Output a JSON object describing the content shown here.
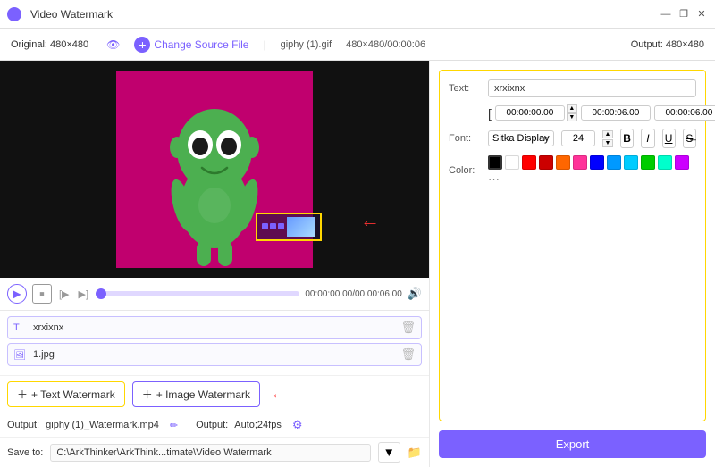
{
  "app": {
    "title": "Video Watermark",
    "logo_color": "#7b61ff"
  },
  "title_bar": {
    "title": "Video Watermark",
    "minimize_label": "—",
    "restore_label": "❐",
    "close_label": "✕"
  },
  "toolbar": {
    "original_label": "Original:",
    "original_dims": "480×480",
    "change_source_label": "Change Source File",
    "filename": "giphy (1).gif",
    "file_dims": "480×480/00:00:06",
    "output_label": "Output:",
    "output_dims": "480×480"
  },
  "playback": {
    "time_current": "00:00:00.00",
    "time_total": "00:00:06.00",
    "time_display": "00:00:00.00/00:00:06.00"
  },
  "watermark_items": [
    {
      "id": "wm-text",
      "icon": "T",
      "label": "xrxixnx"
    },
    {
      "id": "wm-image",
      "icon": "🖼",
      "label": "1.jpg"
    }
  ],
  "add_buttons": {
    "add_text_label": "+ Text Watermark",
    "add_image_label": "+ Image Watermark"
  },
  "output_row": {
    "output_label": "Output:",
    "output_filename": "giphy (1)_Watermark.mp4",
    "output_format_label": "Output:",
    "output_format": "Auto;24fps"
  },
  "save_row": {
    "save_label": "Save to:",
    "save_path": "C:\\ArkThinker\\ArkThink...timate\\Video Watermark"
  },
  "properties_panel": {
    "text_label": "Text:",
    "text_value": "xrxixnx",
    "time_start": "00:00:00.00",
    "time_end": "00:00:06.00",
    "time_end2": "00:00:06.00",
    "font_label": "Font:",
    "font_name": "Sitka Display",
    "font_size": "24",
    "color_label": "Color:",
    "style_bold": "B",
    "style_italic": "I",
    "style_underline": "U",
    "style_strikethrough": "S",
    "export_label": "Export"
  },
  "colors": {
    "swatches": [
      "#000000",
      "#ffffff",
      "#ff0000",
      "#cc0000",
      "#ff6600",
      "#ff3399",
      "#0000ff",
      "#0099ff",
      "#00ccff",
      "#00cc00",
      "#00ffcc",
      "#cc00ff"
    ],
    "accent": "#7b61ff",
    "yellow_border": "#ffd700"
  }
}
